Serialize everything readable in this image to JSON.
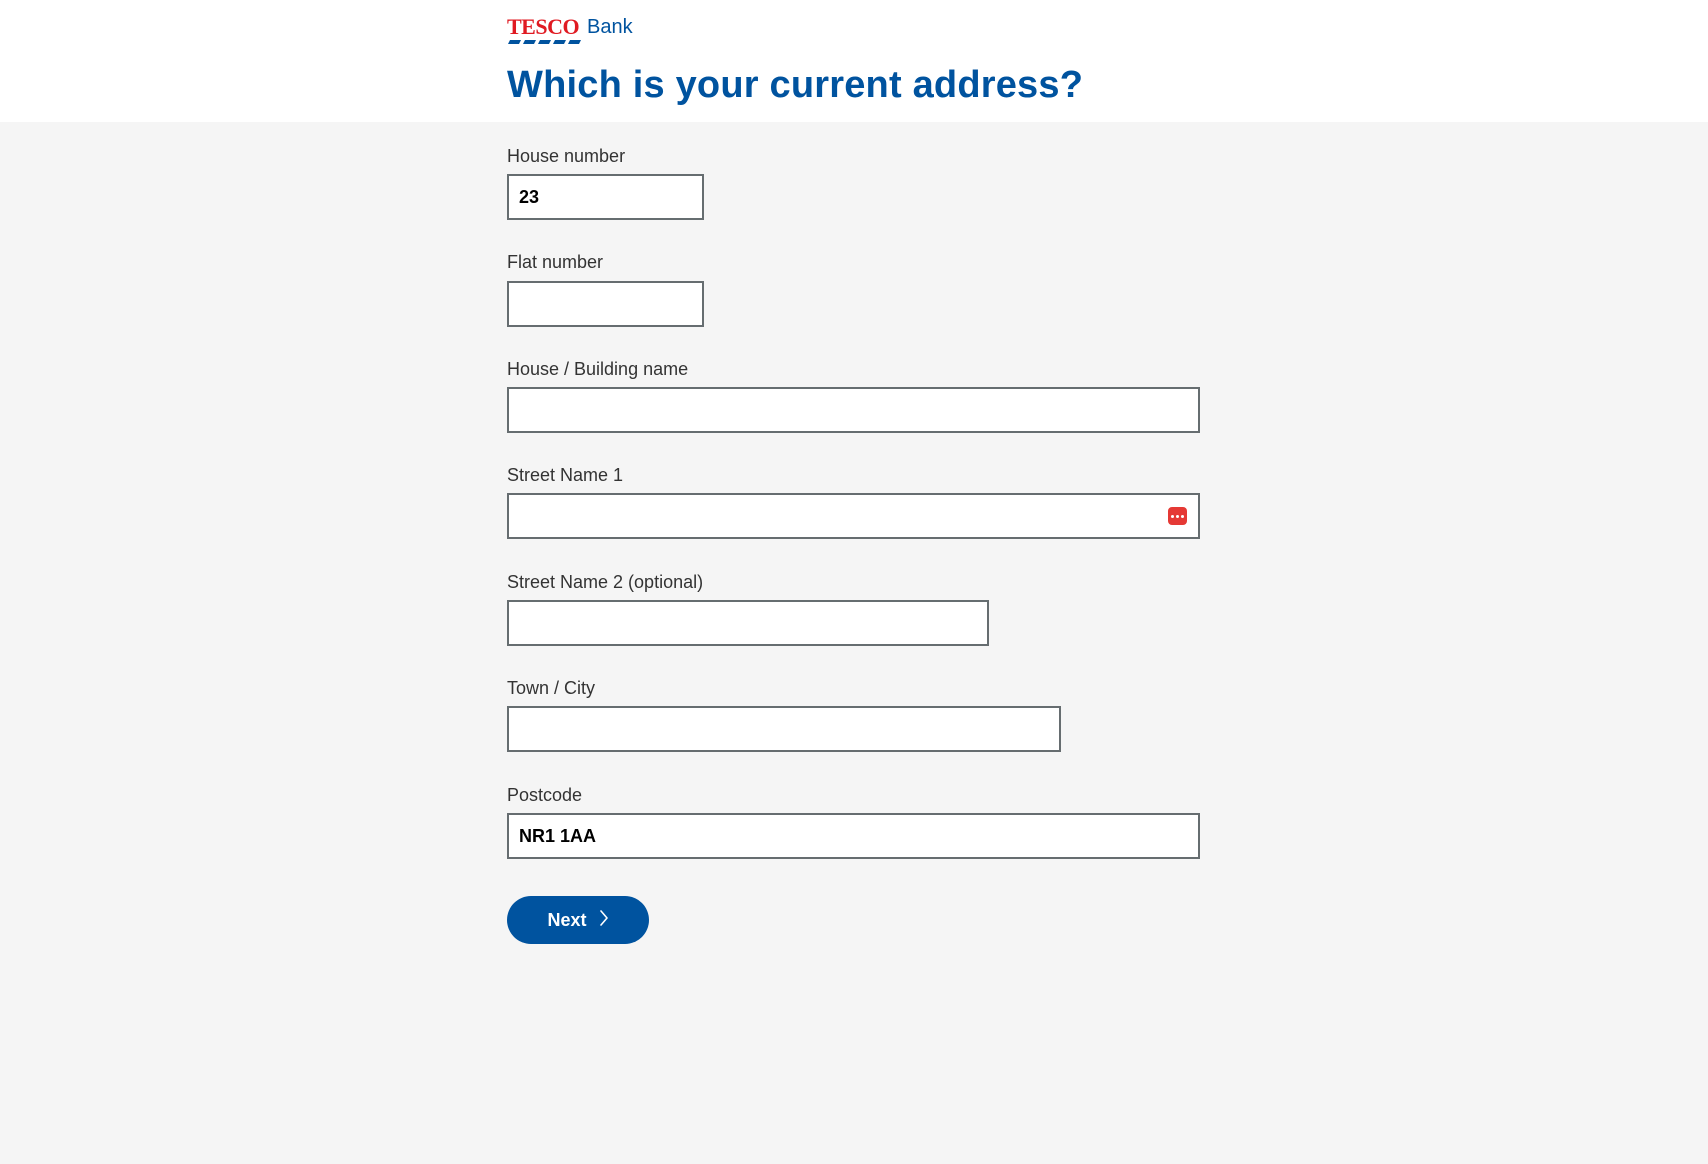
{
  "brand": {
    "logo_text": "TESCO",
    "bank_text": "Bank",
    "primary_color": "#00539f",
    "logo_red": "#e01a22"
  },
  "page": {
    "title": "Which is your current address?"
  },
  "form": {
    "house_number": {
      "label": "House number",
      "value": "23"
    },
    "flat_number": {
      "label": "Flat number",
      "value": ""
    },
    "building_name": {
      "label": "House / Building name",
      "value": ""
    },
    "street_1": {
      "label": "Street Name 1",
      "value": "",
      "autofill_icon": "password-manager-icon"
    },
    "street_2": {
      "label": "Street Name 2 (optional)",
      "value": ""
    },
    "town": {
      "label": "Town / City",
      "value": ""
    },
    "postcode": {
      "label": "Postcode",
      "value": "NR1 1AA"
    }
  },
  "actions": {
    "next_label": "Next",
    "next_icon": "chevron-right-icon"
  }
}
